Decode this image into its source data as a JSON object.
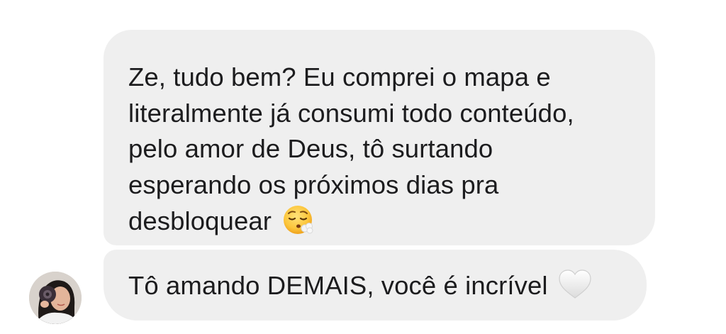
{
  "conversation": {
    "messages": [
      {
        "lines": [
          "Ze, tudo bem? Eu comprei o mapa e",
          "literalmente já consumi todo conteúdo,",
          "pelo amor de Deus, tô surtando",
          "esperando os próximos dias pra",
          "desbloquear"
        ],
        "emoji": "exhaling-face-emoji"
      },
      {
        "lines": [
          "Tô amando DEMAIS, você é incrível"
        ],
        "emoji": "white-heart-emoji"
      }
    ],
    "sender_avatar": "sender-avatar",
    "colors": {
      "bubble_background": "#efefef",
      "text": "#1c1c1e",
      "page_background": "#ffffff"
    }
  }
}
